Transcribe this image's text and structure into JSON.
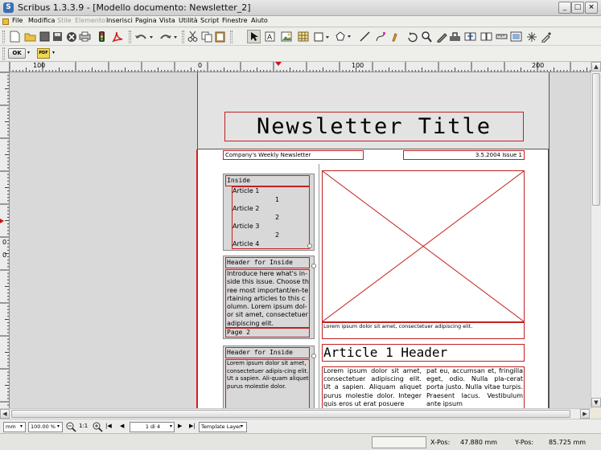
{
  "window": {
    "title": "Scribus 1.3.3.9 - [Modello documento: Newsletter_2]",
    "app_icon_letter": "S",
    "controls": [
      "_",
      "□",
      "×"
    ]
  },
  "menubar": {
    "items": [
      {
        "label": "File",
        "enabled": true
      },
      {
        "label": "Modifica",
        "enabled": true
      },
      {
        "label": "Stile",
        "enabled": false
      },
      {
        "label": "Elemento",
        "enabled": false
      },
      {
        "label": "Inserisci",
        "enabled": true
      },
      {
        "label": "Pagina",
        "enabled": true
      },
      {
        "label": "Vista",
        "enabled": true
      },
      {
        "label": "Utilità",
        "enabled": true
      },
      {
        "label": "Script",
        "enabled": true
      },
      {
        "label": "Finestre",
        "enabled": true
      },
      {
        "label": "Aiuto",
        "enabled": true
      }
    ]
  },
  "toolbar2": {
    "ok_label": "OK",
    "pdf_label": "PDF"
  },
  "rulers": {
    "h_labels": [
      "100",
      "0",
      "100",
      "200"
    ],
    "v_labels": [
      "0",
      "100"
    ]
  },
  "page": {
    "header_title": "Newsletter Title",
    "subtitle_left": "Company's Weekly Newsletter",
    "subtitle_right": "3.5.2004 Issue 1",
    "inside_title": "Inside",
    "toc": [
      {
        "label": "Article 1",
        "page": "1"
      },
      {
        "label": "Article 2",
        "page": "2"
      },
      {
        "label": "Article 3",
        "page": "2"
      },
      {
        "label": "Article 4",
        "page": ""
      }
    ],
    "sidebar1_header": "Header for  Inside",
    "sidebar1_text": "Introduce here what's in-side this issue. Choose three most important/en-tertaining articles to this column. Lorem ipsum dol-or sit amet, consectetuer adipiscing elit.",
    "sidebar1_page": "Page 2",
    "sidebar2_header": "Header for  Inside",
    "sidebar2_text": "Lorem ipsum dolor sit amet, consectetuer adipis-cing elit. Ut a sapien. Ali-quam aliquet purus molestie dolor.",
    "image_caption": "Lorem ipsum dolor sit amet, consectetuer adipiscing elit.",
    "article_header": "Article 1 Header",
    "article_col1": "Lorem ipsum dolor sit amet, consectetuer adipiscing elit. Ut a sapien. Aliquam aliquet purus molestie dolor. Integer quis eros ut erat posuere",
    "article_col2": "pat eu, accumsan et, fringilla eget, odio. Nulla pla-cerat porta justo. Nulla vitae turpis. Praesent lacus. Vestibulum ante ipsum"
  },
  "navbar": {
    "unit": "mm",
    "zoom": "100.00 %",
    "ratio": "1:1",
    "page": "1 di 4",
    "layer": "Template Layer",
    "nav_first": "|◀",
    "nav_prev": "◀",
    "nav_next": "▶",
    "nav_last": "▶|"
  },
  "statusbar": {
    "xpos_label": "X-Pos:",
    "xpos": "47.880 mm",
    "ypos_label": "Y-Pos:",
    "ypos": "85.725 mm"
  },
  "colors": {
    "frame_red": "#c32020",
    "page_white": "#ffffff",
    "canvas_gray": "#d9d9d9",
    "chrome": "#eeeeea"
  }
}
